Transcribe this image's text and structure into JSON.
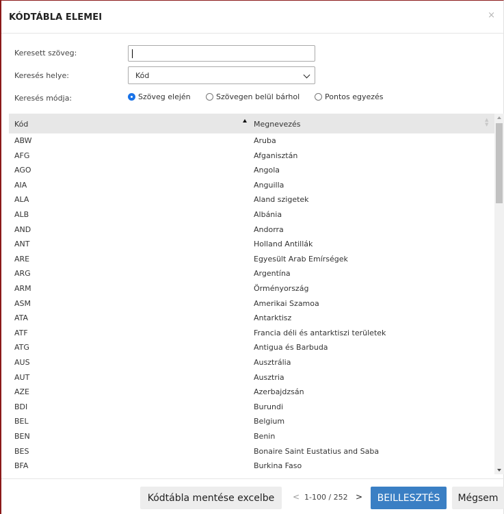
{
  "dialog": {
    "title": "KÓDTÁBLA ELEMEI",
    "close_label": "×"
  },
  "form": {
    "search_text_label": "Keresett szöveg:",
    "search_text_value": "",
    "search_place_label": "Keresés helye:",
    "search_place_value": "Kód",
    "search_mode_label": "Keresés módja:",
    "search_mode_options": [
      "Szöveg elején",
      "Szövegen belül bárhol",
      "Pontos egyezés"
    ],
    "search_mode_selected": "Szöveg elején"
  },
  "grid": {
    "columns": [
      "Kód",
      "Megnevezés"
    ],
    "sort": {
      "column": "Kód",
      "direction": "ascending"
    },
    "rows": [
      [
        "ABW",
        "Aruba"
      ],
      [
        "AFG",
        "Afganisztán"
      ],
      [
        "AGO",
        "Angola"
      ],
      [
        "AIA",
        "Anguilla"
      ],
      [
        "ALA",
        "Aland szigetek"
      ],
      [
        "ALB",
        "Albánia"
      ],
      [
        "AND",
        "Andorra"
      ],
      [
        "ANT",
        "Holland Antillák"
      ],
      [
        "ARE",
        "Egyesült Arab Emírségek"
      ],
      [
        "ARG",
        "Argentína"
      ],
      [
        "ARM",
        "Örményország"
      ],
      [
        "ASM",
        "Amerikai Szamoa"
      ],
      [
        "ATA",
        "Antarktisz"
      ],
      [
        "ATF",
        "Francia déli és antarktiszi területek"
      ],
      [
        "ATG",
        "Antigua és Barbuda"
      ],
      [
        "AUS",
        "Ausztrália"
      ],
      [
        "AUT",
        "Ausztria"
      ],
      [
        "AZE",
        "Azerbajdzsán"
      ],
      [
        "BDI",
        "Burundi"
      ],
      [
        "BEL",
        "Belgium"
      ],
      [
        "BEN",
        "Benin"
      ],
      [
        "BES",
        "Bonaire Saint Eustatius and Saba"
      ],
      [
        "BFA",
        "Burkina Faso"
      ]
    ]
  },
  "footer": {
    "excel_button": "Kódtábla mentése excelbe",
    "prev_label": "<",
    "pager_info": "1-100 / 252",
    "next_label": ">",
    "insert_button": "BEILLESZTÉS",
    "cancel_button": "Mégsem"
  },
  "colors": {
    "accent": "#3a7fc4",
    "radio_checked": "#1a73e8",
    "header_bg": "#e7e7e7",
    "dialog_border": "#8b1a1a"
  },
  "icons": [
    "close-icon",
    "chevron-down-icon",
    "sort-ascending-icon",
    "sort-neutral-icon",
    "scroll-up-icon",
    "scroll-down-icon"
  ]
}
